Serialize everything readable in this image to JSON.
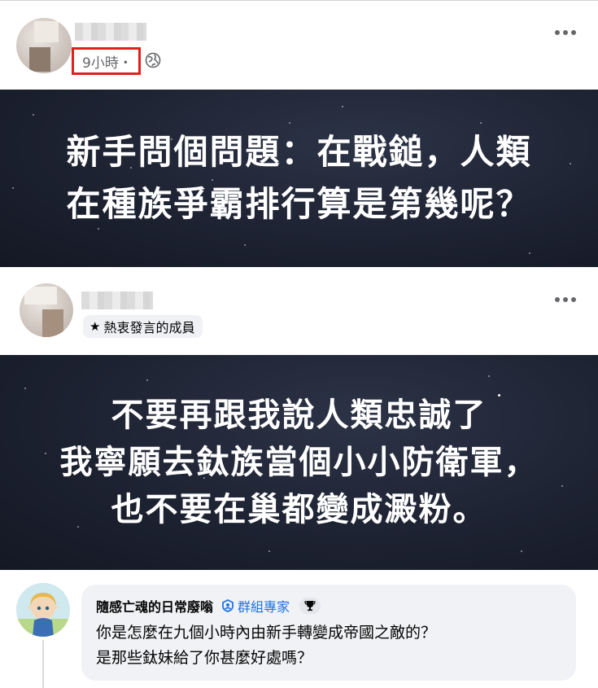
{
  "post": {
    "time_label": "9小時・",
    "privacy_icon": "globe-icon",
    "image_text": "新手問個問題：在戰鎚，人類在種族爭霸排行算是第幾呢？"
  },
  "reply": {
    "badge_label": "熱衷發言的成員",
    "badge_icon": "star-icon",
    "image_text_lines": [
      "不要再跟我說人類忠誠了",
      "我寧願去鈦族當個小小防衛軍，也不要在巢都變成澱粉。"
    ]
  },
  "comment": {
    "author": "隨感亡魂的日常廢嗡",
    "expert_label": "群組專家",
    "text_line1": "你是怎麼在九個小時內由新手轉變成帝國之敵的？",
    "text_line2": "是那些鈦妹給了你甚麼好處嗎？"
  },
  "colors": {
    "highlight": "#e0201a",
    "expert_blue": "#1b74e4",
    "meta_gray": "#65676b"
  }
}
